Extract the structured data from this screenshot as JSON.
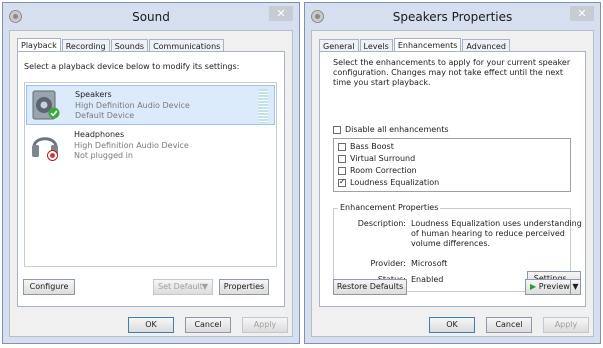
{
  "sound": {
    "title": "Sound",
    "tabs": [
      "Playback",
      "Recording",
      "Sounds",
      "Communications"
    ],
    "instruction": "Select a playback device below to modify its settings:",
    "devices": [
      {
        "name": "Speakers",
        "line1": "High Definition Audio Device",
        "line2": "Default Device"
      },
      {
        "name": "Headphones",
        "line1": "High Definition Audio Device",
        "line2": "Not plugged in"
      }
    ],
    "configure": "Configure",
    "set_default": "Set Default",
    "properties": "Properties",
    "ok": "OK",
    "cancel": "Cancel",
    "apply": "Apply"
  },
  "props": {
    "title": "Speakers Properties",
    "tabs": [
      "General",
      "Levels",
      "Enhancements",
      "Advanced"
    ],
    "instruction": "Select the enhancements to apply for your current speaker configuration. Changes may not take effect until the next time you start playback.",
    "disable_all": "Disable all enhancements",
    "enhancements": [
      {
        "label": "Bass Boost",
        "checked": false
      },
      {
        "label": "Virtual Surround",
        "checked": false
      },
      {
        "label": "Room Correction",
        "checked": false
      },
      {
        "label": "Loudness Equalization",
        "checked": true
      }
    ],
    "group_title": "Enhancement Properties",
    "description_label": "Description:",
    "description": "Loudness Equalization uses understanding of human hearing to reduce perceived volume differences.",
    "provider_label": "Provider:",
    "provider": "Microsoft",
    "status_label": "Status:",
    "status": "Enabled",
    "settings": "Settings...",
    "restore": "Restore Defaults",
    "preview": "Preview",
    "ok": "OK",
    "cancel": "Cancel",
    "apply": "Apply"
  }
}
